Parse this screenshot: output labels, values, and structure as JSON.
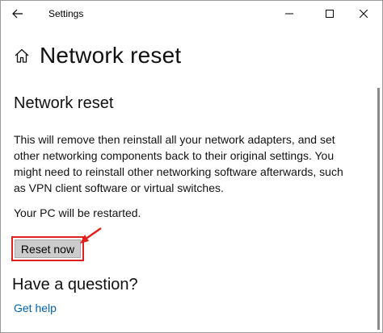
{
  "titlebar": {
    "app_title": "Settings",
    "back_icon": "arrow-left-icon",
    "minimize_icon": "minimize-icon",
    "maximize_icon": "maximize-icon",
    "close_icon": "close-icon"
  },
  "header": {
    "home_icon": "home-icon",
    "page_title": "Network reset"
  },
  "main": {
    "section_title": "Network reset",
    "description": "This will remove then reinstall all your network adapters, and set other networking components back to their original settings. You might need to reinstall other networking software afterwards, such as VPN client software or virtual switches.",
    "restart_note": "Your PC will be restarted.",
    "reset_button_label": "Reset now",
    "annotation_color": "#e0201c"
  },
  "help": {
    "question_heading": "Have a question?",
    "get_help_link": "Get help",
    "link_color": "#0063b1"
  }
}
